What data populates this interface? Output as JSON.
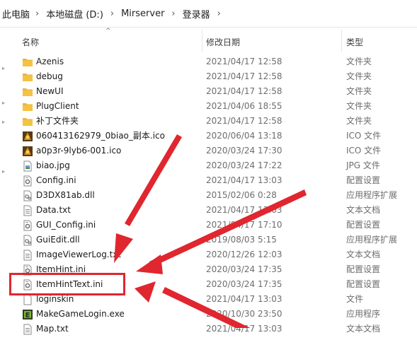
{
  "breadcrumb": {
    "items": [
      "此电脑",
      "本地磁盘 (D:)",
      "Mirserver",
      "登录器"
    ],
    "separator": "›"
  },
  "columns": {
    "name": "名称",
    "date": "修改日期",
    "type": "类型"
  },
  "files": [
    {
      "name": "Azenis",
      "date": "2021/04/17 12:58",
      "type": "文件夹",
      "icon": "folder-icon"
    },
    {
      "name": "debug",
      "date": "2021/04/17 12:58",
      "type": "文件夹",
      "icon": "folder-icon"
    },
    {
      "name": "NewUI",
      "date": "2021/04/17 12:58",
      "type": "文件夹",
      "icon": "folder-icon"
    },
    {
      "name": "PlugClient",
      "date": "2021/04/06 18:55",
      "type": "文件夹",
      "icon": "folder-icon"
    },
    {
      "name": "补丁文件夹",
      "date": "2021/04/17 12:58",
      "type": "文件夹",
      "icon": "folder-icon"
    },
    {
      "name": "060413162979_0biao_副本.ico",
      "date": "2020/06/04 13:18",
      "type": "ICO 文件",
      "icon": "ico-file-icon"
    },
    {
      "name": "a0p3r-9lyb6-001.ico",
      "date": "2020/03/24 17:30",
      "type": "ICO 文件",
      "icon": "ico-file-icon"
    },
    {
      "name": "biao.jpg",
      "date": "2020/03/24 17:22",
      "type": "JPG 文件",
      "icon": "image-file-icon"
    },
    {
      "name": "Config.ini",
      "date": "2021/04/17 13:03",
      "type": "配置设置",
      "icon": "settings-file-icon"
    },
    {
      "name": "D3DX81ab.dll",
      "date": "2015/02/06 0:28",
      "type": "应用程序扩展",
      "icon": "dll-file-icon"
    },
    {
      "name": "Data.txt",
      "date": "2021/04/17 13:03",
      "type": "文本文档",
      "icon": "text-file-icon"
    },
    {
      "name": "GUI_Config.ini",
      "date": "2021/04/17 17:10",
      "type": "配置设置",
      "icon": "settings-file-icon"
    },
    {
      "name": "GuiEdit.dll",
      "date": "2019/08/03 5:15",
      "type": "应用程序扩展",
      "icon": "dll-file-icon"
    },
    {
      "name": "ImageViewerLog.txt",
      "date": "2020/12/26 12:03",
      "type": "文本文档",
      "icon": "text-file-icon"
    },
    {
      "name": "ItemHint.ini",
      "date": "2020/03/24 17:35",
      "type": "配置设置",
      "icon": "settings-file-icon"
    },
    {
      "name": "ItemHintText.ini",
      "date": "2020/03/24 17:35",
      "type": "配置设置",
      "icon": "settings-file-icon"
    },
    {
      "name": "loginskin",
      "date": "2021/04/17 13:03",
      "type": "文件",
      "icon": "generic-file-icon"
    },
    {
      "name": "MakeGameLogin.exe",
      "date": "2020/10/30 23:50",
      "type": "应用程序",
      "icon": "exe-file-icon"
    },
    {
      "name": "Map.txt",
      "date": "2021/04/17 13:03",
      "type": "文本文档",
      "icon": "text-file-icon"
    }
  ],
  "colors": {
    "annotation": "#e0262e",
    "folder": "#f5c242"
  }
}
